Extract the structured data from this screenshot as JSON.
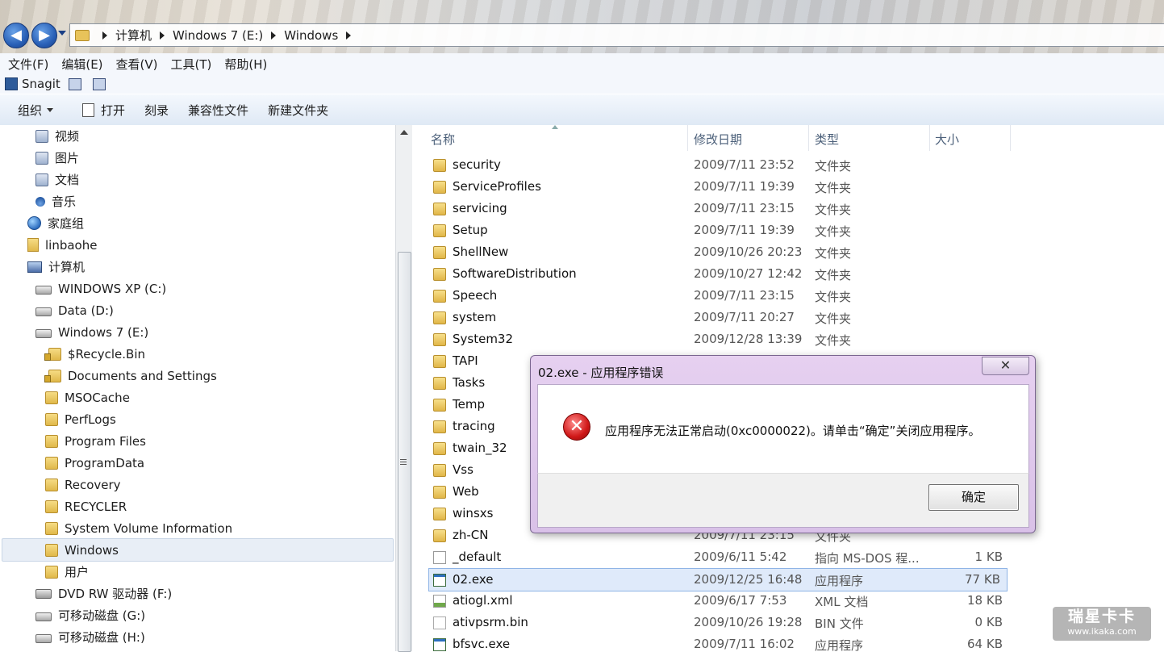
{
  "address": {
    "crumbs": [
      "计算机",
      "Windows 7 (E:)",
      "Windows"
    ]
  },
  "menu": [
    "文件(F)",
    "编辑(E)",
    "查看(V)",
    "工具(T)",
    "帮助(H)"
  ],
  "snagit": {
    "label": "Snagit"
  },
  "toolbar": {
    "organize": "组织",
    "open": "打开",
    "burn": "刻录",
    "compat": "兼容性文件",
    "new_folder": "新建文件夹"
  },
  "nav": [
    {
      "label": "视频",
      "icon": "video-library-icon"
    },
    {
      "label": "图片",
      "icon": "pictures-library-icon"
    },
    {
      "label": "文档",
      "icon": "documents-library-icon"
    },
    {
      "label": "音乐",
      "icon": "music-library-icon"
    },
    {
      "label": "家庭组",
      "icon": "homegroup-icon"
    },
    {
      "label": "linbaohe",
      "icon": "user-folder-icon"
    },
    {
      "label": "计算机",
      "icon": "computer-icon"
    },
    {
      "label": "WINDOWS XP (C:)",
      "icon": "drive-icon"
    },
    {
      "label": "Data (D:)",
      "icon": "drive-icon"
    },
    {
      "label": "Windows 7 (E:)",
      "icon": "system-drive-icon"
    },
    {
      "label": "$Recycle.Bin",
      "icon": "locked-folder-icon"
    },
    {
      "label": "Documents and Settings",
      "icon": "locked-folder-icon"
    },
    {
      "label": "MSOCache",
      "icon": "folder-icon"
    },
    {
      "label": "PerfLogs",
      "icon": "folder-icon"
    },
    {
      "label": "Program Files",
      "icon": "folder-icon"
    },
    {
      "label": "ProgramData",
      "icon": "folder-icon"
    },
    {
      "label": "Recovery",
      "icon": "folder-icon"
    },
    {
      "label": "RECYCLER",
      "icon": "folder-icon"
    },
    {
      "label": "System Volume Information",
      "icon": "folder-icon"
    },
    {
      "label": "Windows",
      "icon": "folder-icon"
    },
    {
      "label": "用户",
      "icon": "folder-icon"
    },
    {
      "label": "DVD RW 驱动器 (F:)",
      "icon": "dvd-drive-icon"
    },
    {
      "label": "可移动磁盘 (G:)",
      "icon": "removable-drive-icon"
    },
    {
      "label": "可移动磁盘 (H:)",
      "icon": "removable-drive-icon"
    }
  ],
  "columns": {
    "name": "名称",
    "date": "修改日期",
    "type": "类型",
    "size": "大小"
  },
  "files": [
    {
      "name": "security",
      "date": "2009/7/11 23:52",
      "type": "文件夹",
      "size": "",
      "kind": "folder"
    },
    {
      "name": "ServiceProfiles",
      "date": "2009/7/11 19:39",
      "type": "文件夹",
      "size": "",
      "kind": "folder"
    },
    {
      "name": "servicing",
      "date": "2009/7/11 23:15",
      "type": "文件夹",
      "size": "",
      "kind": "folder"
    },
    {
      "name": "Setup",
      "date": "2009/7/11 19:39",
      "type": "文件夹",
      "size": "",
      "kind": "folder"
    },
    {
      "name": "ShellNew",
      "date": "2009/10/26 20:23",
      "type": "文件夹",
      "size": "",
      "kind": "folder"
    },
    {
      "name": "SoftwareDistribution",
      "date": "2009/10/27 12:42",
      "type": "文件夹",
      "size": "",
      "kind": "folder"
    },
    {
      "name": "Speech",
      "date": "2009/7/11 23:15",
      "type": "文件夹",
      "size": "",
      "kind": "folder"
    },
    {
      "name": "system",
      "date": "2009/7/11 20:27",
      "type": "文件夹",
      "size": "",
      "kind": "folder"
    },
    {
      "name": "System32",
      "date": "2009/12/28 13:39",
      "type": "文件夹",
      "size": "",
      "kind": "folder"
    },
    {
      "name": "TAPI",
      "date": "",
      "type": "",
      "size": "",
      "kind": "folder"
    },
    {
      "name": "Tasks",
      "date": "",
      "type": "",
      "size": "",
      "kind": "folder"
    },
    {
      "name": "Temp",
      "date": "",
      "type": "",
      "size": "",
      "kind": "folder"
    },
    {
      "name": "tracing",
      "date": "",
      "type": "",
      "size": "",
      "kind": "folder"
    },
    {
      "name": "twain_32",
      "date": "",
      "type": "",
      "size": "",
      "kind": "folder"
    },
    {
      "name": "Vss",
      "date": "",
      "type": "",
      "size": "",
      "kind": "folder"
    },
    {
      "name": "Web",
      "date": "",
      "type": "",
      "size": "",
      "kind": "folder"
    },
    {
      "name": "winsxs",
      "date": "",
      "type": "",
      "size": "",
      "kind": "folder"
    },
    {
      "name": "zh-CN",
      "date": "2009/7/11 23:15",
      "type": "文件夹",
      "size": "",
      "kind": "folder"
    },
    {
      "name": "_default",
      "date": "2009/6/11 5:42",
      "type": "指向 MS-DOS 程...",
      "size": "1 KB",
      "kind": "shortcut"
    },
    {
      "name": "02.exe",
      "date": "2009/12/25 16:48",
      "type": "应用程序",
      "size": "77 KB",
      "kind": "app",
      "selected": true
    },
    {
      "name": "atiogl.xml",
      "date": "2009/6/17 7:53",
      "type": "XML 文档",
      "size": "18 KB",
      "kind": "xml"
    },
    {
      "name": "ativpsrm.bin",
      "date": "2009/10/26 19:28",
      "type": "BIN 文件",
      "size": "0 KB",
      "kind": "bin"
    },
    {
      "name": "bfsvc.exe",
      "date": "2009/7/11 16:02",
      "type": "应用程序",
      "size": "64 KB",
      "kind": "app"
    }
  ],
  "dialog": {
    "title": "02.exe - 应用程序错误",
    "message": "应用程序无法正常启动(0xc0000022)。请单击“确定”关闭应用程序。",
    "ok": "确定",
    "close": "✕"
  },
  "watermark": {
    "brand": "瑞星卡卡",
    "url": "www.ikaka.com"
  },
  "colors": {
    "selection": "#dfeafa",
    "dialog_frame": "#e6d0f0",
    "error_red": "#d01818"
  }
}
